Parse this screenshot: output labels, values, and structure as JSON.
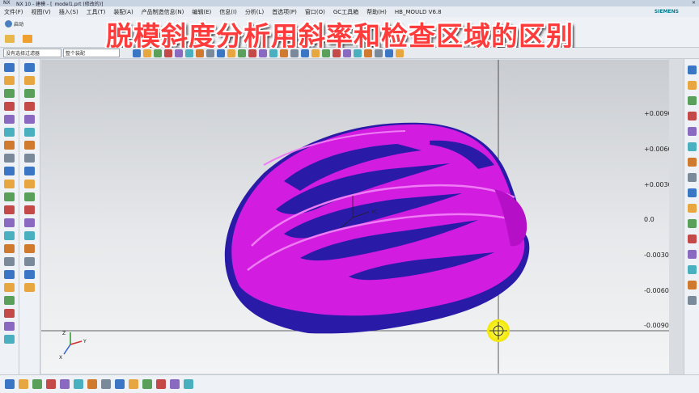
{
  "window": {
    "title": "NX 10 - 建模 - [_model1.prt (修改的)]",
    "app_badge": "NX"
  },
  "menu": {
    "items": [
      "文件(F)",
      "视图(V)",
      "插入(S)",
      "工具(T)",
      "装配(A)",
      "产品制造信息(N)",
      "编辑(E)",
      "信息(I)",
      "分析(L)",
      "首选项(P)",
      "窗口(O)",
      "GC工具箱",
      "帮助(H)",
      "HB_MOULD V6.8"
    ],
    "brand": "SIEMENS"
  },
  "toolbar": {
    "start_label": "启动",
    "selection_filter": "没有选择过滤器",
    "assembly_scope": "整个装配"
  },
  "banner": {
    "text": "脱模斜度分析用斜率和检查区域的区别"
  },
  "viewport": {
    "wcs_label": "YC",
    "triad_labels": [
      "Z",
      "Y",
      "X"
    ],
    "legend": {
      "labels": [
        "+0.0090",
        "+0.0060",
        "+0.0030",
        "0.0",
        "-0.0030",
        "-0.0060",
        "-0.0090"
      ],
      "colors": [
        "#d40000",
        "#ff8000",
        "#f0e000",
        "#00c800",
        "#00c8c8",
        "#2a7cff",
        "#2000c8"
      ]
    },
    "model_color": "#d21ce0",
    "model_shadow_color": "#2a1aa8"
  },
  "colors": {
    "banner_text": "#ff3b3b",
    "banner_outline": "#ffffff",
    "cursor_highlight": "#ffff33"
  }
}
